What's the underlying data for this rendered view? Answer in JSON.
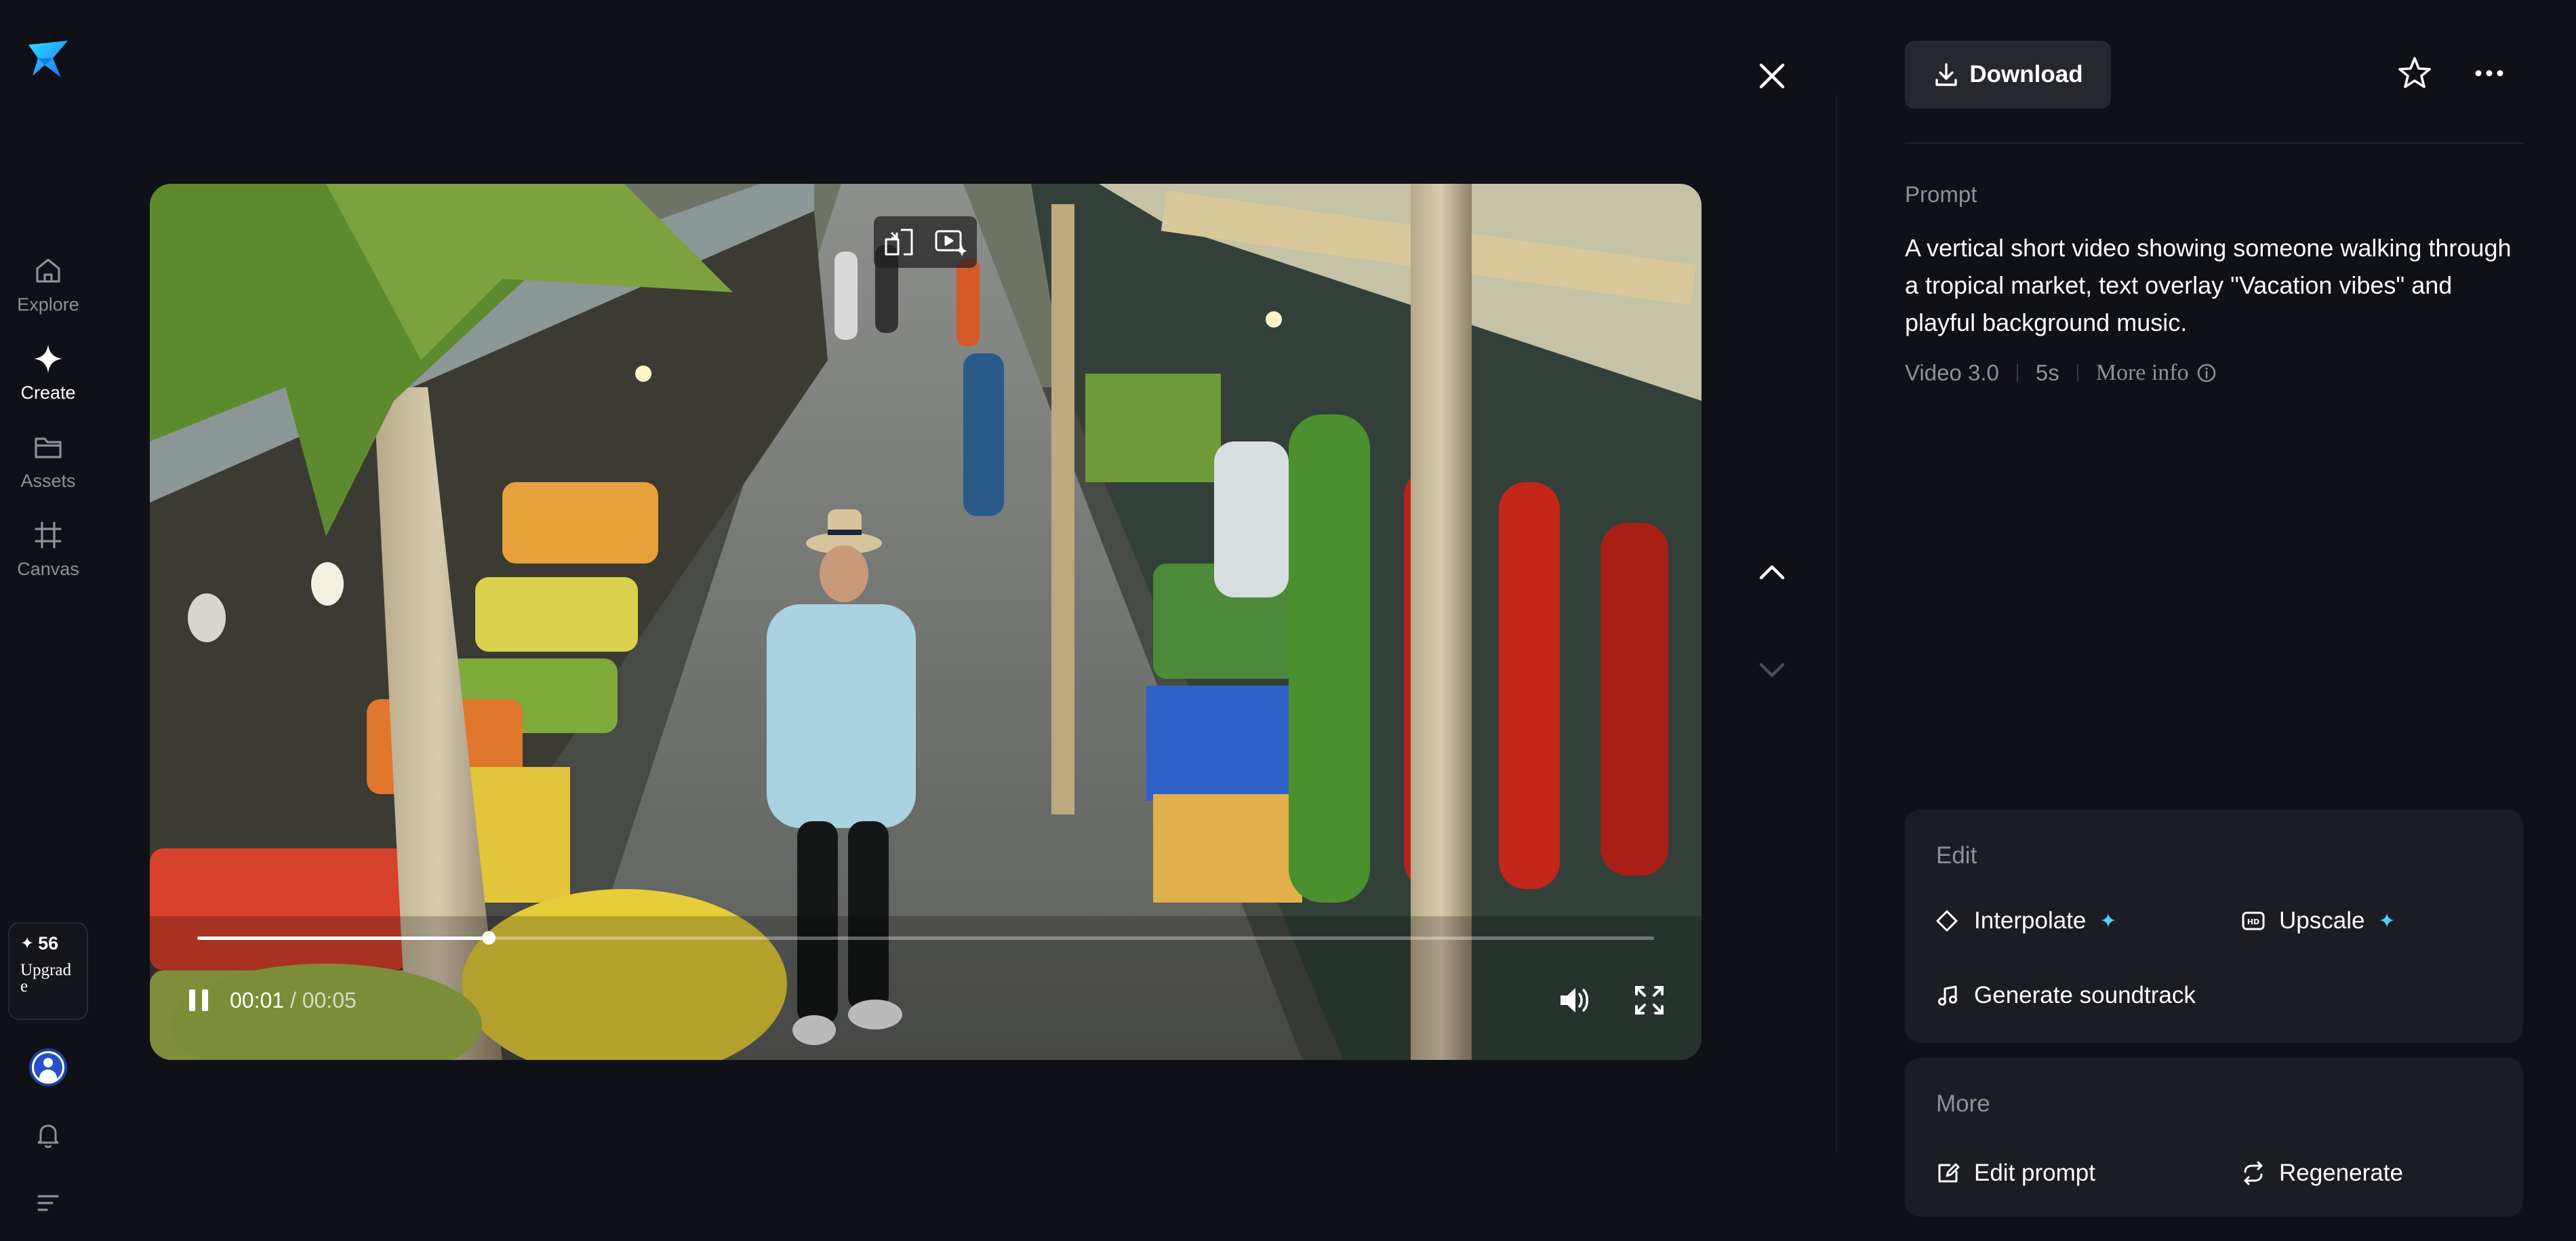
{
  "nav": {
    "items": [
      {
        "label": "Explore",
        "icon": "home-icon"
      },
      {
        "label": "Create",
        "icon": "sparkle-icon"
      },
      {
        "label": "Assets",
        "icon": "folder-icon"
      },
      {
        "label": "Canvas",
        "icon": "canvas-icon"
      }
    ],
    "credits": "56",
    "upgrade_label": "Upgrade"
  },
  "player": {
    "current_time": "00:01",
    "total_time": "/ 00:05",
    "progress": 0.2
  },
  "panel": {
    "download_label": "Download",
    "prompt_label": "Prompt",
    "prompt_text": "A vertical short video showing someone walking through a tropical market, text overlay \"Vacation vibes\" and playful background music.",
    "model": "Video 3.0",
    "duration": "5s",
    "more_info": "More info",
    "edit": {
      "title": "Edit",
      "interpolate": "Interpolate",
      "upscale": "Upscale",
      "soundtrack": "Generate soundtrack"
    },
    "more": {
      "title": "More",
      "edit_prompt": "Edit prompt",
      "regenerate": "Regenerate"
    }
  },
  "colors": {
    "background": "#101116",
    "card": "#1b1d22",
    "accent": "#4fd1ff"
  }
}
